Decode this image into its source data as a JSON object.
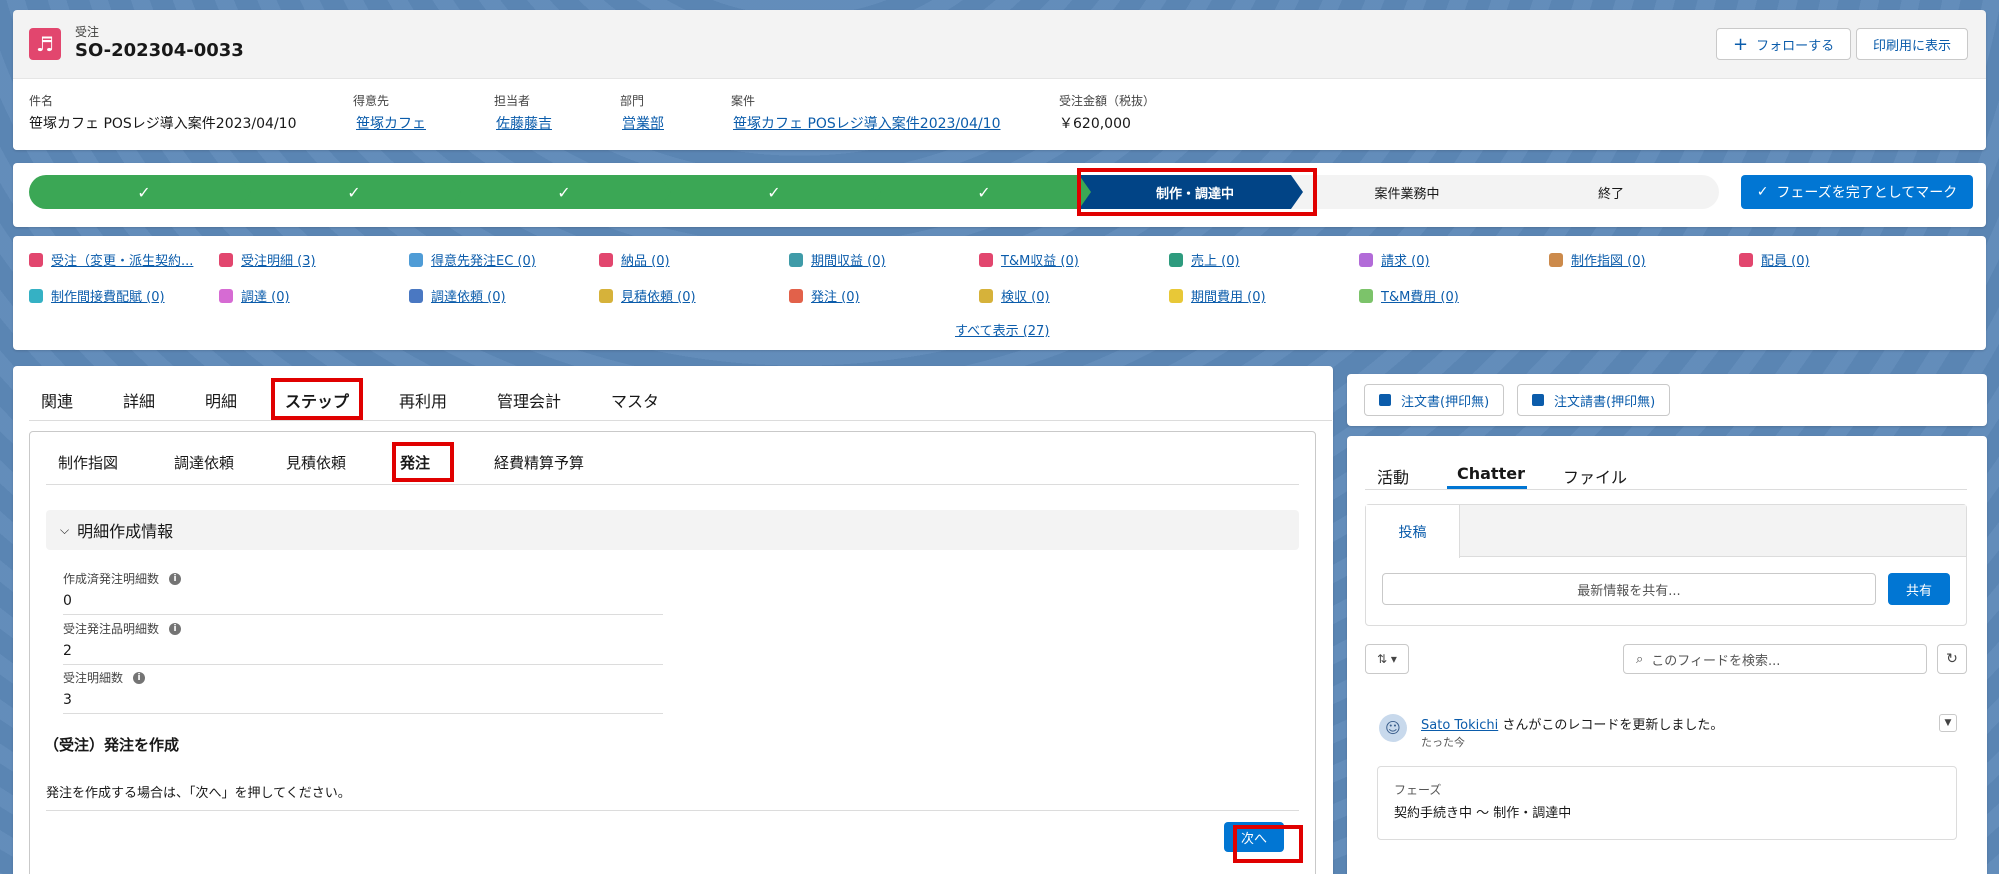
{
  "header": {
    "object_type": "受注",
    "record_name": "SO-202304-0033",
    "follow_label": "フォローする",
    "print_label": "印刷用に表示",
    "fields": [
      {
        "label": "件名",
        "value": "笹塚カフェ POSレジ導入案件2023/04/10",
        "link": false
      },
      {
        "label": "得意先",
        "value": "笹塚カフェ",
        "link": true
      },
      {
        "label": "担当者",
        "value": "佐藤藤吉",
        "link": true
      },
      {
        "label": "部門",
        "value": "営業部",
        "link": true
      },
      {
        "label": "案件",
        "value": "笹塚カフェ POSレジ導入案件2023/04/10",
        "link": true
      },
      {
        "label": "受注金額（税抜）",
        "value": "￥620,000",
        "link": false
      }
    ]
  },
  "path": {
    "current_stage": "制作・調達中",
    "stages_after": [
      "案件業務中",
      "終了"
    ],
    "mark_complete_label": "フェーズを完了としてマーク",
    "completed_count": 5
  },
  "related_links": {
    "row1": [
      "受注（変更・派生契約...",
      "受注明細 (3)",
      "得意先発注EC (0)",
      "納品 (0)",
      "期間収益 (0)",
      "T&M収益 (0)",
      "売上 (0)",
      "請求 (0)",
      "制作指図 (0)",
      "配員 (0)"
    ],
    "row2": [
      "制作間接費配賦 (0)",
      "調達 (0)",
      "調達依頼 (0)",
      "見積依頼 (0)",
      "発注 (0)",
      "検収 (0)",
      "期間費用 (0)",
      "T&M費用 (0)"
    ],
    "row1_colors": [
      "#e2466e",
      "#e2466e",
      "#4f9cd6",
      "#e2466e",
      "#3f9ba8",
      "#e2466e",
      "#2e9b7e",
      "#b26bd8",
      "#cc8a4b",
      "#e2466e"
    ],
    "row2_colors": [
      "#35b1c4",
      "#d66bd3",
      "#4a78c2",
      "#d6b23a",
      "#e2614a",
      "#d6b23a",
      "#e8c837",
      "#7cc36a"
    ],
    "show_all": "すべて表示 (27)"
  },
  "main": {
    "tabs": [
      "関連",
      "詳細",
      "明細",
      "ステップ",
      "再利用",
      "管理会計",
      "マスタ"
    ],
    "subtabs": [
      "制作指図",
      "調達依頼",
      "見積依頼",
      "発注",
      "経費精算予算"
    ],
    "section_title": "明細作成情報",
    "fields": [
      {
        "label": "作成済発注明細数",
        "value": "0"
      },
      {
        "label": "受注発注品明細数",
        "value": "2"
      },
      {
        "label": "受注明細数",
        "value": "3"
      }
    ],
    "flow_title": "（受注）発注を作成",
    "flow_text": "発注を作成する場合は、「次へ」を押してください。",
    "next_label": "次へ"
  },
  "right": {
    "print_buttons": [
      "注文書(押印無)",
      "注文請書(押印無)"
    ],
    "feed_tabs": [
      "活動",
      "Chatter",
      "ファイル"
    ],
    "post_tab": "投稿",
    "share_placeholder": "最新情報を共有...",
    "share_label": "共有",
    "search_placeholder": "このフィードを検索...",
    "feed_item": {
      "user": "Sato Tokichi",
      "action": "さんがこのレコードを更新しました。",
      "time": "たった今",
      "field": "フェーズ",
      "change": "契約手続き中 ～ 制作・調達中"
    }
  },
  "colors": {
    "accent": "#0176d3",
    "complete": "#3ba755",
    "current": "#014486",
    "highlight": "#e00000"
  }
}
